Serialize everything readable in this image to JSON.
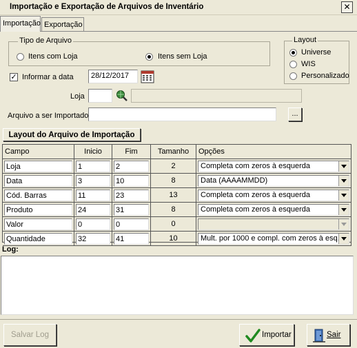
{
  "window": {
    "title": "Importação e Exportação de Arquivos de Inventário",
    "close_glyph": "✕"
  },
  "tabs": [
    {
      "label": "Importação",
      "active": true
    },
    {
      "label": "Exportação",
      "active": false
    }
  ],
  "tipo_arquivo": {
    "legend": "Tipo de Arquivo",
    "options": [
      {
        "label": "Itens com Loja",
        "checked": false
      },
      {
        "label": "Itens sem Loja",
        "checked": true
      }
    ]
  },
  "layout": {
    "legend": "Layout",
    "options": [
      {
        "label": "Universe",
        "checked": true
      },
      {
        "label": "WIS",
        "checked": false
      },
      {
        "label": "Personalizado",
        "checked": false
      }
    ]
  },
  "informar_data": {
    "label": "Informar a data",
    "checked": true,
    "check_glyph": "✓",
    "date": "28/12/2017",
    "calendar_icon": "calendar-icon"
  },
  "loja": {
    "label": "Loja",
    "value": "",
    "search_icon": "search-globe-icon",
    "description": ""
  },
  "arquivo": {
    "label": "Arquivo a ser Importado",
    "value": "",
    "browse_label": "..."
  },
  "section_button": "Layout do Arquivo de Importação",
  "grid": {
    "headers": [
      "Campo",
      "Inicio",
      "Fim",
      "Tamanho",
      "Opções"
    ],
    "rows": [
      {
        "campo": "Loja",
        "inicio": "1",
        "fim": "2",
        "tamanho": "2",
        "opcao": "Completa com zeros à esquerda",
        "opcao_enabled": true
      },
      {
        "campo": "Data",
        "inicio": "3",
        "fim": "10",
        "tamanho": "8",
        "opcao": "Data (AAAAMMDD)",
        "opcao_enabled": true
      },
      {
        "campo": "Cód. Barras",
        "inicio": "11",
        "fim": "23",
        "tamanho": "13",
        "opcao": "Completa com zeros à esquerda",
        "opcao_enabled": true
      },
      {
        "campo": "Produto",
        "inicio": "24",
        "fim": "31",
        "tamanho": "8",
        "opcao": "Completa com zeros à esquerda",
        "opcao_enabled": true
      },
      {
        "campo": "Valor",
        "inicio": "0",
        "fim": "0",
        "tamanho": "0",
        "opcao": "",
        "opcao_enabled": false
      },
      {
        "campo": "Quantidade",
        "inicio": "32",
        "fim": "41",
        "tamanho": "10",
        "opcao": "Mult. por 1000 e compl. com zeros à esq.",
        "opcao_enabled": true
      }
    ]
  },
  "log": {
    "label": "Log:",
    "content": ""
  },
  "buttons": {
    "salvar_log": "Salvar Log",
    "importar": "Importar",
    "sair": "Sair"
  },
  "colors": {
    "face": "#ece9d8",
    "check_green": "#1f8a1f",
    "door_icon": "#3a6ab0"
  }
}
